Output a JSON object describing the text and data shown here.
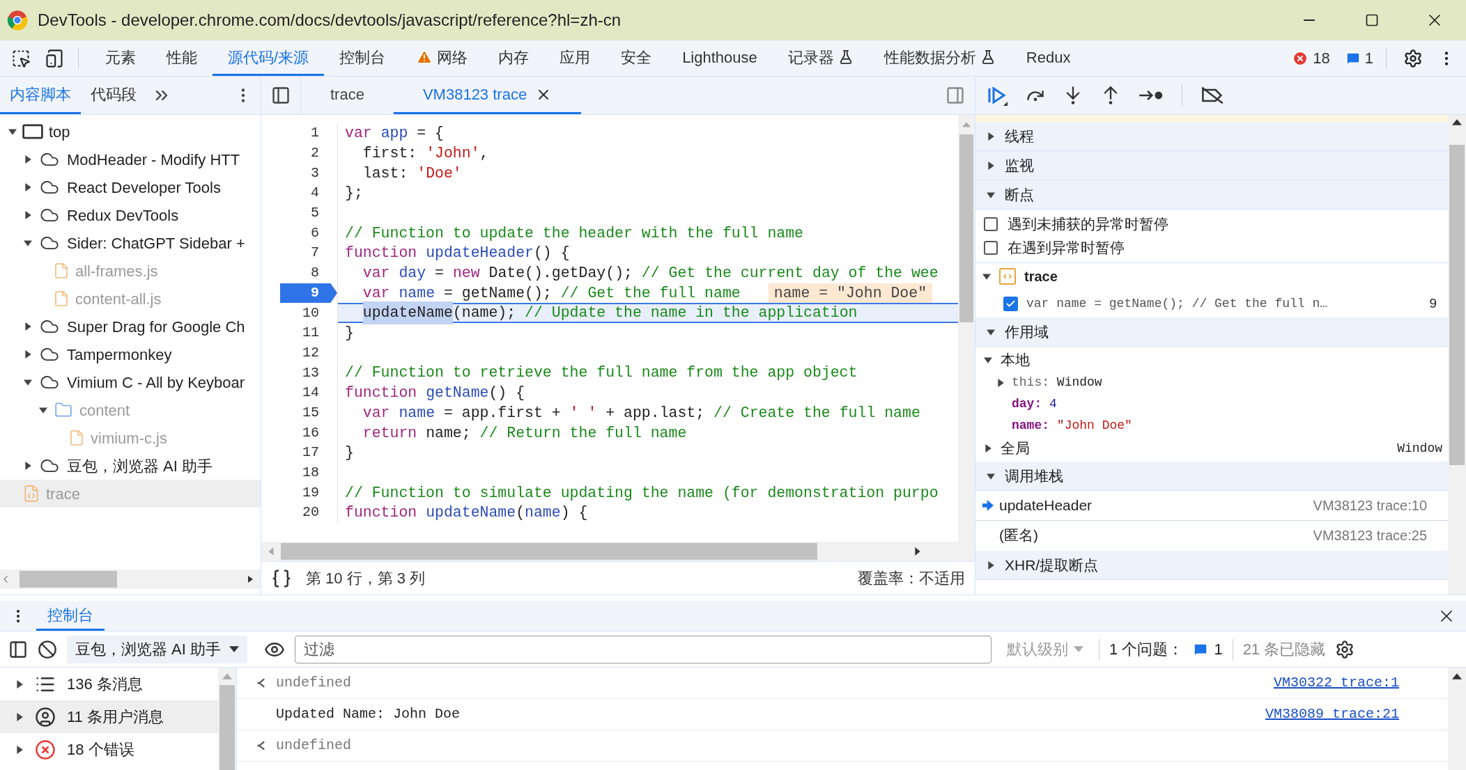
{
  "window": {
    "title": "DevTools - developer.chrome.com/docs/devtools/javascript/reference?hl=zh-cn"
  },
  "main_tabs": [
    {
      "label": "元素",
      "selected": false
    },
    {
      "label": "性能",
      "selected": false
    },
    {
      "label": "源代码/来源",
      "selected": true
    },
    {
      "label": "控制台",
      "selected": false
    },
    {
      "label": "网络",
      "selected": false,
      "kind": "warning"
    },
    {
      "label": "内存",
      "selected": false
    },
    {
      "label": "应用",
      "selected": false
    },
    {
      "label": "安全",
      "selected": false
    },
    {
      "label": "Lighthouse",
      "selected": false
    },
    {
      "label": "记录器",
      "selected": false,
      "kind": "experimental"
    },
    {
      "label": "性能数据分析",
      "selected": false,
      "kind": "experimental"
    },
    {
      "label": "Redux",
      "selected": false
    }
  ],
  "issue_counts": {
    "errors": "18",
    "messages": "1"
  },
  "navigator": {
    "tabs": [
      {
        "label": "内容脚本",
        "selected": true
      },
      {
        "label": "代码段",
        "selected": false
      }
    ],
    "tree": [
      {
        "kind": "frame",
        "label": "top",
        "expanded": true,
        "selected": false,
        "children": [
          {
            "kind": "extension",
            "label": "ModHeader - Modify HTT",
            "expanded": false,
            "selected": false
          },
          {
            "kind": "extension",
            "label": "React Developer Tools",
            "expanded": false,
            "selected": false
          },
          {
            "kind": "extension",
            "label": "Redux DevTools",
            "expanded": false,
            "selected": false
          },
          {
            "kind": "extension",
            "label": "Sider: ChatGPT Sidebar +",
            "expanded": true,
            "selected": false,
            "children": [
              {
                "kind": "file",
                "label": "all-frames.js",
                "selected": false
              },
              {
                "kind": "file",
                "label": "content-all.js",
                "selected": false
              }
            ]
          },
          {
            "kind": "extension",
            "label": "Super Drag for Google Ch",
            "expanded": false,
            "selected": false
          },
          {
            "kind": "extension",
            "label": "Tampermonkey",
            "expanded": false,
            "selected": false
          },
          {
            "kind": "extension",
            "label": "Vimium C - All by Keyboar",
            "expanded": true,
            "selected": false,
            "children": [
              {
                "kind": "folder",
                "label": "content",
                "expanded": true,
                "selected": false,
                "children": [
                  {
                    "kind": "file",
                    "label": "vimium-c.js",
                    "selected": false
                  }
                ]
              }
            ]
          },
          {
            "kind": "extension",
            "label": "豆包，浏览器 AI 助手",
            "expanded": false,
            "selected": false
          }
        ]
      },
      {
        "kind": "script",
        "label": "trace",
        "selected": true
      }
    ]
  },
  "editor": {
    "tabs": [
      {
        "label": "trace",
        "selected": false,
        "closable": false
      },
      {
        "label": "VM38123 trace",
        "selected": true,
        "closable": true
      }
    ],
    "lines": [
      {
        "number": "1",
        "breakpoint": false,
        "current": false,
        "tokens": [
          {
            "kind": "kw",
            "text": "var"
          },
          {
            "kind": "def",
            "text": " app"
          },
          {
            "kind": "plain",
            "text": " = {"
          }
        ]
      },
      {
        "number": "2",
        "breakpoint": false,
        "current": false,
        "tokens": [
          {
            "kind": "plain",
            "text": "  first: "
          },
          {
            "kind": "str",
            "text": "'John'"
          },
          {
            "kind": "plain",
            "text": ","
          }
        ]
      },
      {
        "number": "3",
        "breakpoint": false,
        "current": false,
        "tokens": [
          {
            "kind": "plain",
            "text": "  last: "
          },
          {
            "kind": "str",
            "text": "'Doe'"
          }
        ]
      },
      {
        "number": "4",
        "breakpoint": false,
        "current": false,
        "tokens": [
          {
            "kind": "plain",
            "text": "};"
          }
        ]
      },
      {
        "number": "5",
        "breakpoint": false,
        "current": false
      },
      {
        "number": "6",
        "breakpoint": false,
        "current": false,
        "tokens": [
          {
            "kind": "comment",
            "text": "// Function to update the header with the full name"
          }
        ]
      },
      {
        "number": "7",
        "breakpoint": false,
        "current": false,
        "tokens": [
          {
            "kind": "kw",
            "text": "function"
          },
          {
            "kind": "def",
            "text": " updateHeader"
          },
          {
            "kind": "plain",
            "text": "() {"
          }
        ]
      },
      {
        "number": "8",
        "breakpoint": false,
        "current": false,
        "tokens": [
          {
            "kind": "kw",
            "text": "  var"
          },
          {
            "kind": "def",
            "text": " day"
          },
          {
            "kind": "plain",
            "text": " = "
          },
          {
            "kind": "kw",
            "text": "new"
          },
          {
            "kind": "plain",
            "text": " Date().getDay(); "
          },
          {
            "kind": "comment",
            "text": "// Get the current day of the wee"
          }
        ]
      },
      {
        "number": "9",
        "breakpoint": true,
        "current": false,
        "inline_value": "name = \"John Doe\"",
        "tokens": [
          {
            "kind": "kw",
            "text": "  var"
          },
          {
            "kind": "def",
            "text": " name"
          },
          {
            "kind": "plain",
            "text": " = getName(); "
          },
          {
            "kind": "comment",
            "text": "// Get the full name"
          }
        ]
      },
      {
        "number": "10",
        "breakpoint": false,
        "current": true,
        "tokens": [
          {
            "kind": "sel",
            "text": "  updateName"
          },
          {
            "kind": "plain",
            "text": "(name); "
          },
          {
            "kind": "comment",
            "text": "// Update the name in the application"
          }
        ]
      },
      {
        "number": "11",
        "breakpoint": false,
        "current": false,
        "tokens": [
          {
            "kind": "plain",
            "text": "}"
          }
        ]
      },
      {
        "number": "12",
        "breakpoint": false,
        "current": false
      },
      {
        "number": "13",
        "breakpoint": false,
        "current": false,
        "tokens": [
          {
            "kind": "comment",
            "text": "// Function to retrieve the full name from the app object"
          }
        ]
      },
      {
        "number": "14",
        "breakpoint": false,
        "current": false,
        "tokens": [
          {
            "kind": "kw",
            "text": "function"
          },
          {
            "kind": "def",
            "text": " getName"
          },
          {
            "kind": "plain",
            "text": "() {"
          }
        ]
      },
      {
        "number": "15",
        "breakpoint": false,
        "current": false,
        "tokens": [
          {
            "kind": "kw",
            "text": "  var"
          },
          {
            "kind": "def",
            "text": " name"
          },
          {
            "kind": "plain",
            "text": " = app.first + "
          },
          {
            "kind": "str",
            "text": "' '"
          },
          {
            "kind": "plain",
            "text": " + app.last; "
          },
          {
            "kind": "comment",
            "text": "// Create the full name"
          }
        ]
      },
      {
        "number": "16",
        "breakpoint": false,
        "current": false,
        "tokens": [
          {
            "kind": "kw",
            "text": "  return"
          },
          {
            "kind": "plain",
            "text": " name; "
          },
          {
            "kind": "comment",
            "text": "// Return the full name"
          }
        ]
      },
      {
        "number": "17",
        "breakpoint": false,
        "current": false,
        "tokens": [
          {
            "kind": "plain",
            "text": "}"
          }
        ]
      },
      {
        "number": "18",
        "breakpoint": false,
        "current": false
      },
      {
        "number": "19",
        "breakpoint": false,
        "current": false,
        "tokens": [
          {
            "kind": "comment",
            "text": "// Function to simulate updating the name (for demonstration purpo"
          }
        ]
      },
      {
        "number": "20",
        "breakpoint": false,
        "current": false,
        "tokens": [
          {
            "kind": "kw",
            "text": "function"
          },
          {
            "kind": "def",
            "text": " updateName"
          },
          {
            "kind": "plain",
            "text": "("
          },
          {
            "kind": "def",
            "text": "name"
          },
          {
            "kind": "plain",
            "text": ") {"
          }
        ]
      }
    ],
    "position": "第 10 行，第 3 列",
    "coverage": "覆盖率：不适用"
  },
  "debugger": {
    "sections": [
      {
        "title": "线程",
        "expanded": false
      },
      {
        "title": "监视",
        "expanded": false
      },
      {
        "kind": "breakpoints",
        "title": "断点",
        "expanded": true,
        "options": [
          {
            "label": "遇到未捕获的异常时暂停",
            "checked": false
          },
          {
            "label": "在遇到异常时暂停",
            "checked": false
          }
        ],
        "files": [
          {
            "name": "trace",
            "expanded": true,
            "breakpoints": [
              {
                "code": "var name = getName(); // Get the full n…",
                "line": "9",
                "checked": true
              }
            ]
          }
        ]
      },
      {
        "kind": "scope",
        "title": "作用域",
        "expanded": true,
        "scopes": [
          {
            "name": "本地",
            "expanded": true,
            "vars": [
              {
                "kind": "object",
                "name": "this:",
                "value": "Window",
                "expanded": false
              },
              {
                "kind": "number",
                "name": "day:",
                "value": "4"
              },
              {
                "kind": "string",
                "name": "name:",
                "value": "\"John Doe\""
              }
            ]
          },
          {
            "name": "全局",
            "expanded": false,
            "value": "Window"
          }
        ]
      },
      {
        "kind": "callstack",
        "title": "调用堆栈",
        "expanded": true,
        "frames": [
          {
            "name": "updateHeader",
            "location": "VM38123 trace:10",
            "selected": true
          },
          {
            "name": "(匿名)",
            "location": "VM38123 trace:25",
            "selected": false
          }
        ]
      },
      {
        "title": "XHR/提取断点",
        "expanded": false
      }
    ]
  },
  "console": {
    "tabs": [
      {
        "label": "控制台",
        "selected": true
      }
    ],
    "context": "豆包，浏览器 AI 助手",
    "filter_placeholder": "过滤",
    "level": "默认级别",
    "issues_label": "1 个问题：",
    "issues_count": "1",
    "hidden": "21 条已隐藏",
    "sidebar": [
      {
        "kind": "messages",
        "label": "136 条消息",
        "selected": false
      },
      {
        "kind": "user",
        "label": "11 条用户消息",
        "selected": true
      },
      {
        "kind": "errors",
        "label": "18 个错误",
        "selected": false
      }
    ],
    "messages": [
      {
        "kind": "result",
        "text": "undefined",
        "source": "VM30322 trace:1"
      },
      {
        "kind": "log",
        "text": "Updated Name: John Doe",
        "source": "VM38089 trace:21"
      },
      {
        "kind": "result",
        "text": "undefined"
      }
    ]
  }
}
